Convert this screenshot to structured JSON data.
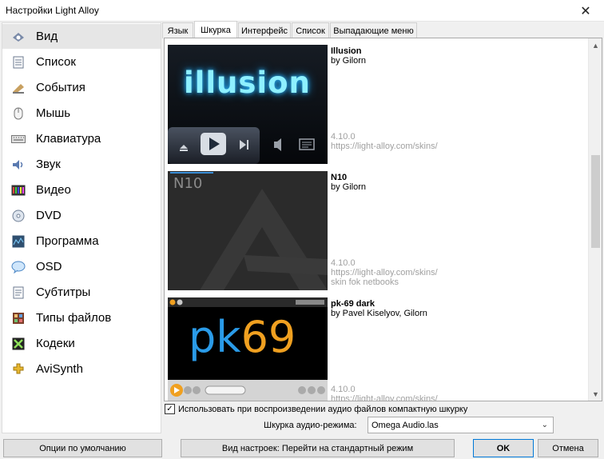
{
  "window": {
    "title": "Настройки Light Alloy",
    "close_glyph": "✕"
  },
  "sidebar": {
    "items": [
      {
        "label": "Вид",
        "icon": "view-icon",
        "selected": true
      },
      {
        "label": "Список",
        "icon": "list-icon"
      },
      {
        "label": "События",
        "icon": "events-icon"
      },
      {
        "label": "Мышь",
        "icon": "mouse-icon"
      },
      {
        "label": "Клавиатура",
        "icon": "keyboard-icon"
      },
      {
        "label": "Звук",
        "icon": "speaker-icon"
      },
      {
        "label": "Видео",
        "icon": "video-icon"
      },
      {
        "label": "DVD",
        "icon": "dvd-icon"
      },
      {
        "label": "Программа",
        "icon": "program-icon"
      },
      {
        "label": "OSD",
        "icon": "osd-icon"
      },
      {
        "label": "Субтитры",
        "icon": "subtitles-icon"
      },
      {
        "label": "Типы файлов",
        "icon": "filetypes-icon"
      },
      {
        "label": "Кодеки",
        "icon": "codecs-icon"
      },
      {
        "label": "AviSynth",
        "icon": "avisynth-icon"
      }
    ]
  },
  "tabs": [
    {
      "label": "Язык"
    },
    {
      "label": "Шкурка",
      "active": true
    },
    {
      "label": "Интерфейс"
    },
    {
      "label": "Список"
    },
    {
      "label": "Выпадающие меню"
    }
  ],
  "skins": [
    {
      "name": "Illusion",
      "author": "by Gilorn",
      "version": "4.10.0",
      "url": "https://light-alloy.com/skins/",
      "note": "",
      "preview_text": "illusion"
    },
    {
      "name": "N10",
      "author": "by Gilorn",
      "version": "4.10.0",
      "url": "https://light-alloy.com/skins/",
      "note": "skin fok netbooks",
      "preview_text": "N10"
    },
    {
      "name": "pk-69 dark",
      "author": "by Pavel Kiselyov, Gilorn",
      "version": "4.10.0",
      "url": "https://light-alloy.com/skins/",
      "note": "",
      "preview_text_a": "pk",
      "preview_text_b": "69"
    }
  ],
  "options": {
    "compact_audio_label": "Использовать при воспроизведении аудио файлов компактную шкурку",
    "compact_audio_checked": true,
    "check_glyph": "✓",
    "audio_skin_label": "Шкурка аудио-режима:",
    "audio_skin_value": "Omega Audio.las"
  },
  "buttons": {
    "defaults": "Опции по умолчанию",
    "view_mode": "Вид настроек: Перейти на стандартный режим",
    "ok": "OK",
    "cancel": "Отмена"
  },
  "colors": {
    "accent": "#0078d7",
    "illusion_glow": "#6fe6ff",
    "pk_blue": "#2a9be8",
    "pk_orange": "#f0a020"
  }
}
